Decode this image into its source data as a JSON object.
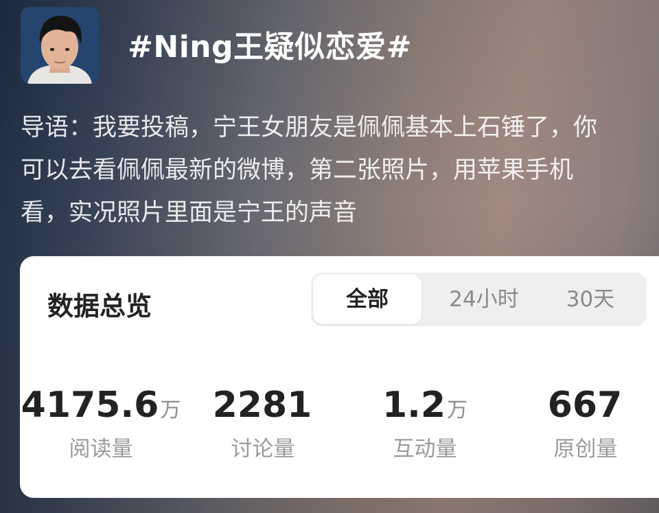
{
  "topic": {
    "title": "#Ning王疑似恋爱#",
    "intro_lines": [
      "导语：我要投稿，宁王女朋友是佩佩基本上石锤了，你",
      "可以去看佩佩最新的微博，第二张照片，用苹果手机",
      "看，实况照片里面是宁王的声音"
    ]
  },
  "overview": {
    "title": "数据总览",
    "tabs": [
      {
        "label": "全部",
        "active": true
      },
      {
        "label": "24小时",
        "active": false
      },
      {
        "label": "30天",
        "active": false
      }
    ],
    "stats": [
      {
        "value": "4175.6",
        "unit": "万",
        "label": "阅读量"
      },
      {
        "value": "2281",
        "unit": "",
        "label": "讨论量"
      },
      {
        "value": "1.2",
        "unit": "万",
        "label": "互动量"
      },
      {
        "value": "667",
        "unit": "",
        "label": "原创量"
      }
    ]
  },
  "colors": {
    "title_text": "#ffffff",
    "card_bg": "#ffffff",
    "primary_text": "#222222",
    "secondary_text": "#9a9a9a",
    "segment_bg": "#efefef"
  }
}
